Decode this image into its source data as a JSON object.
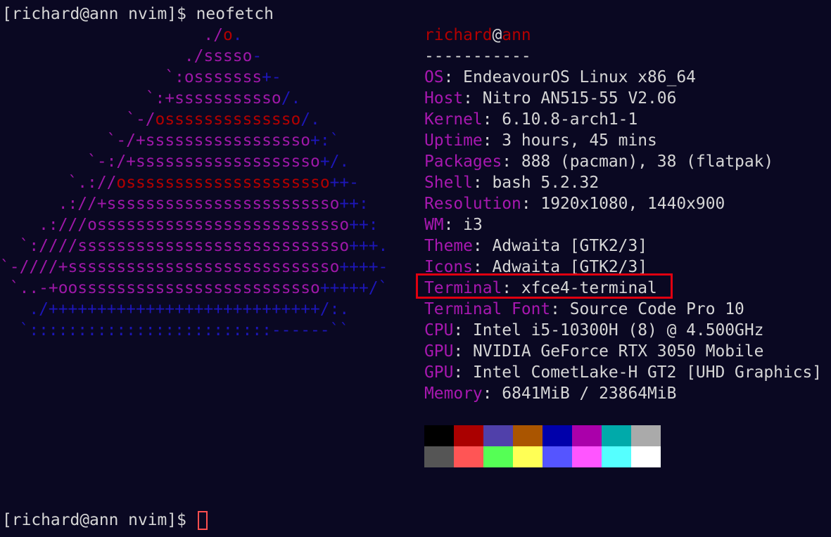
{
  "terminal": {
    "prompt_user": "[richard@ann nvim]$ ",
    "command": "neofetch",
    "prompt_bottom": "[richard@ann nvim]$ "
  },
  "logo_lines": [
    [
      [
        "                     ",
        "c-purple"
      ],
      [
        "./",
        "c-purple"
      ],
      [
        "o",
        "c-red"
      ],
      [
        ".",
        "c-blue"
      ]
    ],
    [
      [
        "                   ",
        "c-purple"
      ],
      [
        "./",
        "c-purple"
      ],
      [
        "sssso",
        "c-purple"
      ],
      [
        "-",
        "c-blue"
      ]
    ],
    [
      [
        "                 ",
        "c-purple"
      ],
      [
        "`:",
        "c-purple"
      ],
      [
        "osssssss",
        "c-purple"
      ],
      [
        "+-",
        "c-blue"
      ]
    ],
    [
      [
        "               ",
        "c-purple"
      ],
      [
        "`:+",
        "c-purple"
      ],
      [
        "sssssssssso",
        "c-purple"
      ],
      [
        "/.",
        "c-blue"
      ]
    ],
    [
      [
        "             ",
        "c-purple"
      ],
      [
        "`-/",
        "c-purple"
      ],
      [
        "ossssssssssssso",
        "c-red"
      ],
      [
        "/.",
        "c-blue"
      ]
    ],
    [
      [
        "           ",
        "c-purple"
      ],
      [
        "`-/+",
        "c-purple"
      ],
      [
        "sssssssssssssssso",
        "c-purple"
      ],
      [
        "+:`",
        "c-blue"
      ]
    ],
    [
      [
        "         ",
        "c-purple"
      ],
      [
        "`-:/+",
        "c-purple"
      ],
      [
        "sssssssssssssssssso",
        "c-purple"
      ],
      [
        "+/.",
        "c-blue"
      ]
    ],
    [
      [
        "       ",
        "c-purple"
      ],
      [
        "`.://",
        "c-purple"
      ],
      [
        "osssssssssssssssssssso",
        "c-red"
      ],
      [
        "++-",
        "c-blue"
      ]
    ],
    [
      [
        "      ",
        "c-purple"
      ],
      [
        ".://+",
        "c-purple"
      ],
      [
        "ssssssssssssssssssssssso",
        "c-purple"
      ],
      [
        "++:",
        "c-blue"
      ]
    ],
    [
      [
        "    ",
        "c-purple"
      ],
      [
        ".:///",
        "c-purple"
      ],
      [
        "ossssssssssssssssssssssssso",
        "c-purple"
      ],
      [
        "++:",
        "c-blue"
      ]
    ],
    [
      [
        "  ",
        "c-purple"
      ],
      [
        "`:////",
        "c-purple"
      ],
      [
        "ssssssssssssssssssssssssssso",
        "c-purple"
      ],
      [
        "+++.",
        "c-blue"
      ]
    ],
    [
      [
        "",
        "c-purple"
      ],
      [
        "`-////+",
        "c-purple"
      ],
      [
        "ssssssssssssssssssssssssssso",
        "c-purple"
      ],
      [
        "++++-",
        "c-blue"
      ]
    ],
    [
      [
        " ",
        "c-purple"
      ],
      [
        "`..-+",
        "c-purple"
      ],
      [
        "oosssssssssssssssssssssssso",
        "c-purple"
      ],
      [
        "+++++/`",
        "c-blue"
      ]
    ],
    [
      [
        "   ",
        "c-purple"
      ],
      [
        "./++++++++++++++++++++++++++++/:.",
        "c-blue"
      ]
    ],
    [
      [
        "  ",
        "c-purple"
      ],
      [
        "`:::::::::::::::::::::::::------``",
        "c-blue"
      ]
    ]
  ],
  "neofetch": {
    "user": "richard",
    "at": "@",
    "host": "ann",
    "separator": "-----------",
    "rows": [
      {
        "key": "OS",
        "value": "EndeavourOS Linux x86_64"
      },
      {
        "key": "Host",
        "value": "Nitro AN515-55 V2.06"
      },
      {
        "key": "Kernel",
        "value": "6.10.8-arch1-1"
      },
      {
        "key": "Uptime",
        "value": "3 hours, 45 mins"
      },
      {
        "key": "Packages",
        "value": "888 (pacman), 38 (flatpak)"
      },
      {
        "key": "Shell",
        "value": "bash 5.2.32"
      },
      {
        "key": "Resolution",
        "value": "1920x1080, 1440x900"
      },
      {
        "key": "WM",
        "value": "i3"
      },
      {
        "key": "Theme",
        "value": "Adwaita [GTK2/3]"
      },
      {
        "key": "Icons",
        "value": "Adwaita [GTK2/3]"
      },
      {
        "key": "Terminal",
        "value": "xfce4-terminal"
      },
      {
        "key": "Terminal Font",
        "value": "Source Code Pro 10"
      },
      {
        "key": "CPU",
        "value": "Intel i5-10300H (8) @ 4.500GHz"
      },
      {
        "key": "GPU",
        "value": "NVIDIA GeForce RTX 3050 Mobile"
      },
      {
        "key": "GPU",
        "value": "Intel CometLake-H GT2 [UHD Graphics]"
      },
      {
        "key": "Memory",
        "value": "6841MiB / 23864MiB"
      }
    ]
  },
  "palette": {
    "normal": [
      "#000000",
      "#aa0000",
      "#5040aa",
      "#aa5500",
      "#0000aa",
      "#aa00aa",
      "#00aaaa",
      "#aaaaaa"
    ],
    "bright": [
      "#555555",
      "#ff5555",
      "#55ff55",
      "#ffff55",
      "#5555ff",
      "#ff55ff",
      "#55ffff",
      "#ffffff"
    ]
  },
  "colors": {
    "background": "#0a0822",
    "foreground": "#d6d6d6",
    "accent_key": "#a818b0",
    "accent_user": "#b30000",
    "highlight": "#e00010"
  }
}
